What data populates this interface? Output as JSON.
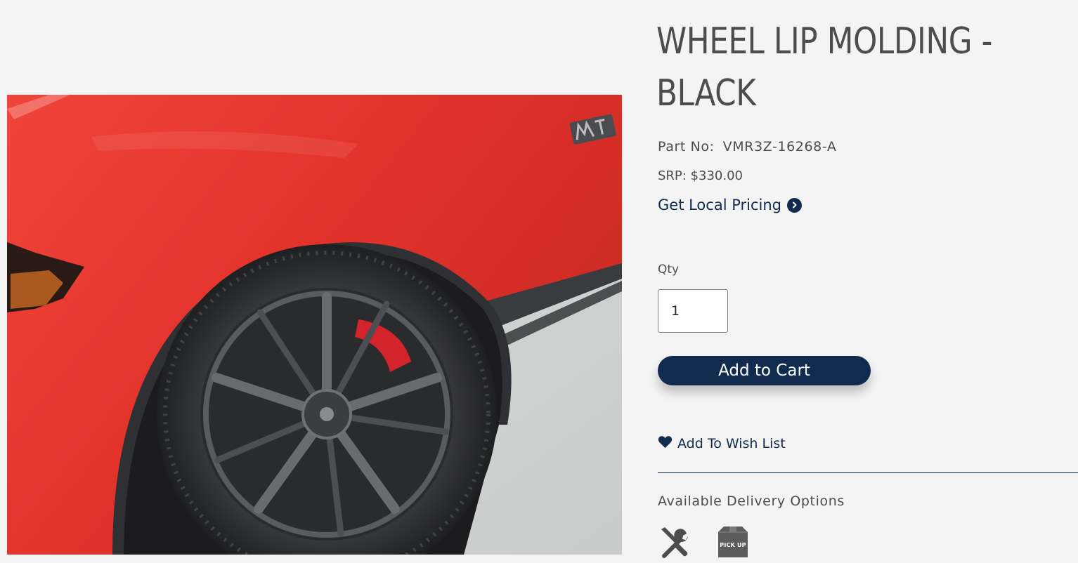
{
  "product": {
    "title": "WHEEL LIP MOLDING - BLACK",
    "part_label": "Part No:",
    "part_number": "VMR3Z-16268-A",
    "srp": "SRP: $330.00",
    "local_pricing_label": "Get Local Pricing",
    "image_icon": "car-wheel-photo"
  },
  "purchase": {
    "qty_label": "Qty",
    "qty_value": "1",
    "add_to_cart_label": "Add to Cart",
    "wishlist_label": "Add To Wish List"
  },
  "delivery": {
    "heading": "Available Delivery Options",
    "options": [
      {
        "icon": "install-tools-icon"
      },
      {
        "icon": "pickup-box-icon",
        "label": "PICK UP"
      }
    ]
  },
  "colors": {
    "brand_navy": "#102b4e",
    "body_text": "#4d4d4d",
    "background": "#f4f4f4",
    "car_red": "#e8362f"
  }
}
